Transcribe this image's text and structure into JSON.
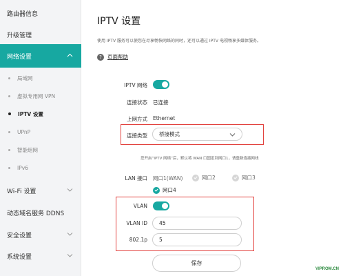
{
  "sidebar": {
    "router_info": "路由器信息",
    "upgrade": "升级管理",
    "network_settings": "网络设置",
    "sub_items": [
      "局域网",
      "虚拟专用网 VPN",
      "IPTV 设置",
      "UPnP",
      "智能组网",
      "IPv6"
    ],
    "wifi_settings": "Wi-Fi 设置",
    "ddns": "动态域名服务 DDNS",
    "security": "安全设置",
    "system": "系统设置"
  },
  "main": {
    "title": "IPTV 设置",
    "description": "使用 IPTV 服务可以使您在尽享畅快网络的同时，还可以通过 IPTV 电视畅享多媒体服务。",
    "help": "页面帮助",
    "iptv_label": "IPTV 网络",
    "status_label": "连接状态",
    "status_value": "已连接",
    "wan_label": "上网方式",
    "wan_value": "Ethernet",
    "type_label": "连接类型",
    "type_value": "桥接模式",
    "hint": "您开启“IPTV 网络”后，默认将 WAN 口固定到网口1，请重新连接网线",
    "lan_label": "LAN 接口",
    "ports": [
      "网口1(WAN)",
      "网口2",
      "网口3",
      "网口4"
    ],
    "vlan_label": "VLAN",
    "vlan_id_label": "VLAN ID",
    "vlan_id_value": "45",
    "priority_label": "802.1p",
    "priority_value": "5",
    "save": "保存"
  },
  "watermark": "VIPROM.CN",
  "colors": {
    "accent": "#17a8a1",
    "highlight": "#e2403c"
  },
  "states": {
    "iptv_enabled": true,
    "vlan_enabled": true,
    "port4_checked": true
  }
}
